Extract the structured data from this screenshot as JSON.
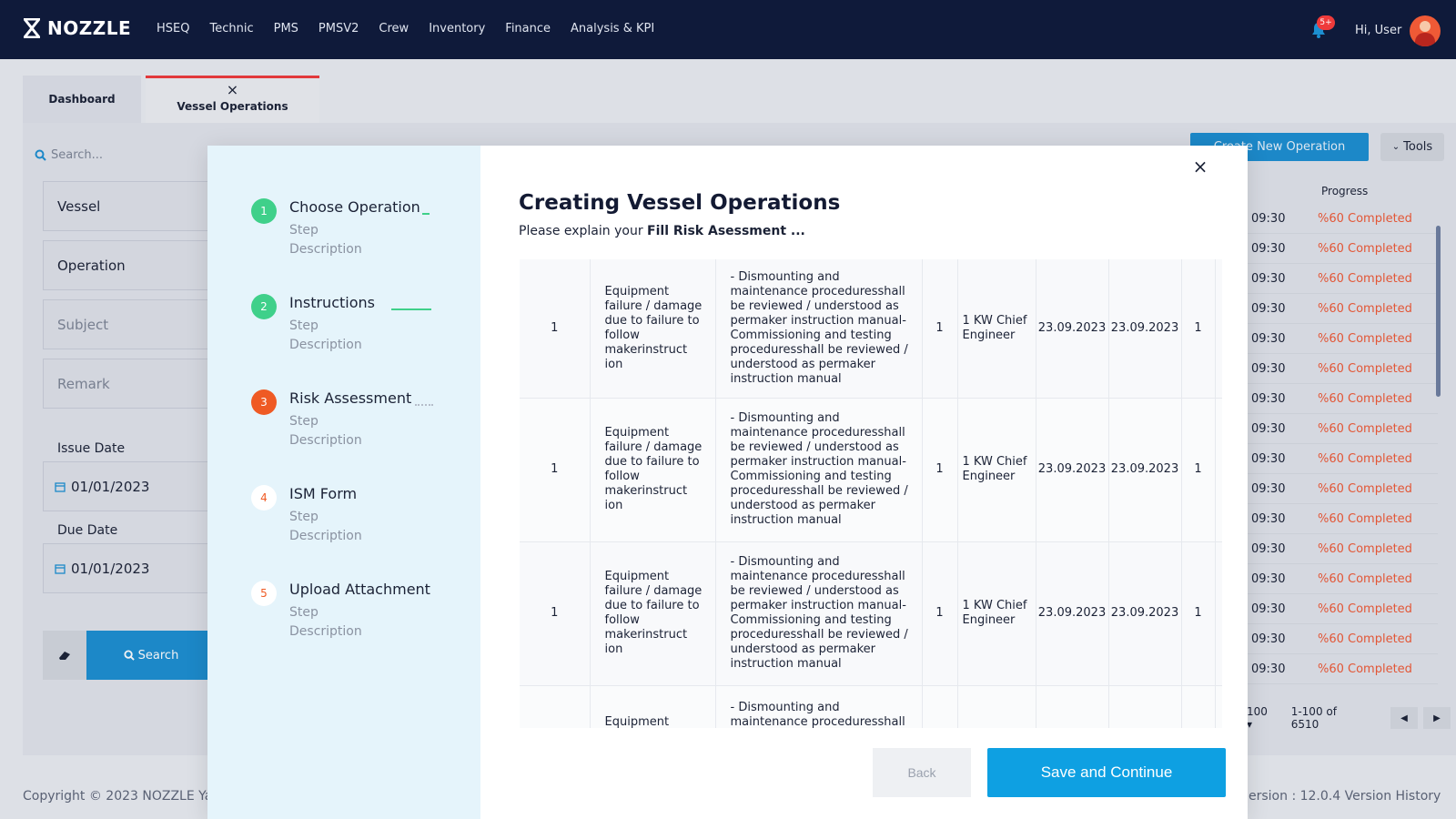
{
  "brand": {
    "name": "NOZZLE"
  },
  "nav": {
    "items": [
      "HSEQ",
      "Technic",
      "PMS",
      "PMSV2",
      "Crew",
      "Inventory",
      "Finance",
      "Analysis & KPI"
    ]
  },
  "header": {
    "notification_badge": "5+",
    "greeting": "Hi, User"
  },
  "tabs": {
    "dashboard": "Dashboard",
    "vessel_operations": "Vessel Operations"
  },
  "filters": {
    "search_placeholder": "Search...",
    "vessel": "Vessel",
    "operation": "Operation",
    "subject": "Subject",
    "remark": "Remark",
    "issue_date_label": "Issue Date",
    "issue_date": "01/01/2023",
    "due_date_label": "Due Date",
    "due_date": "01/01/2023",
    "search_button": "Search"
  },
  "toolbar": {
    "create": "Create New Operation",
    "tools": "Tools"
  },
  "list": {
    "progress_header": "Progress",
    "rows": [
      {
        "time": "09:30",
        "progress": "%60 Completed"
      },
      {
        "time": "09:30",
        "progress": "%60 Completed"
      },
      {
        "time": "09:30",
        "progress": "%60 Completed"
      },
      {
        "time": "09:30",
        "progress": "%60 Completed"
      },
      {
        "time": "09:30",
        "progress": "%60 Completed"
      },
      {
        "time": "09:30",
        "progress": "%60 Completed"
      },
      {
        "time": "09:30",
        "progress": "%60 Completed"
      },
      {
        "time": "09:30",
        "progress": "%60 Completed"
      },
      {
        "time": "09:30",
        "progress": "%60 Completed"
      },
      {
        "time": "09:30",
        "progress": "%60 Completed"
      },
      {
        "time": "09:30",
        "progress": "%60 Completed"
      },
      {
        "time": "09:30",
        "progress": "%60 Completed"
      },
      {
        "time": "09:30",
        "progress": "%60 Completed"
      },
      {
        "time": "09:30",
        "progress": "%60 Completed"
      },
      {
        "time": "09:30",
        "progress": "%60 Completed"
      },
      {
        "time": "09:30",
        "progress": "%60 Completed"
      }
    ],
    "per_page": "100",
    "range": "1-100 of 6510"
  },
  "footer": {
    "copyright": "Copyright © 2023  NOZZLE Ya",
    "version": "ersion : 12.0.4   Version History"
  },
  "modal": {
    "title": "Creating Vessel Operations",
    "subtitle_prefix": "Please explain your ",
    "subtitle_bold": "Fill Risk Asessment ...",
    "steps": [
      {
        "num": "1",
        "title": "Choose Operation",
        "line1": "Step",
        "line2": "Description"
      },
      {
        "num": "2",
        "title": "Instructions",
        "line1": "Step",
        "line2": "Description"
      },
      {
        "num": "3",
        "title": "Risk Assessment",
        "line1": "Step",
        "line2": "Description"
      },
      {
        "num": "4",
        "title": "ISM Form",
        "line1": "Step",
        "line2": "Description"
      },
      {
        "num": "5",
        "title": "Upload Attachment",
        "line1": "Step",
        "line2": "Description"
      }
    ],
    "rows": [
      {
        "a": "1",
        "hazard": "Equipment failure / damage due to failure to follow makerinstruct ion",
        "measure": "- Dismounting and maintenance proceduresshall be reviewed / understood as permaker instruction manual- Commissioning and testing proceduresshall be reviewed / understood as permaker instruction manual",
        "b": "1",
        "resp": "1 KW Chief Engineer",
        "d1": "23.09.2023",
        "d2": "23.09.2023",
        "c": "1"
      },
      {
        "a": "1",
        "hazard": "Equipment failure / damage due to failure to follow makerinstruct ion",
        "measure": "- Dismounting and maintenance proceduresshall be reviewed / understood as permaker instruction manual- Commissioning and testing proceduresshall be reviewed / understood as permaker instruction manual",
        "b": "1",
        "resp": "1 KW Chief Engineer",
        "d1": "23.09.2023",
        "d2": "23.09.2023",
        "c": "1"
      },
      {
        "a": "1",
        "hazard": "Equipment failure / damage due to failure to follow makerinstruct ion",
        "measure": "- Dismounting and maintenance proceduresshall be reviewed / understood as permaker instruction manual- Commissioning and testing proceduresshall be reviewed / understood as permaker instruction manual",
        "b": "1",
        "resp": "1 KW Chief Engineer",
        "d1": "23.09.2023",
        "d2": "23.09.2023",
        "c": "1"
      },
      {
        "a": "",
        "hazard": "Equipment",
        "measure": "- Dismounting and maintenance proceduresshall",
        "b": "",
        "resp": "",
        "d1": "",
        "d2": "",
        "c": ""
      }
    ],
    "back": "Back",
    "save": "Save and Continue"
  },
  "colors": {
    "navy": "#0f1a3a",
    "primary": "#0ea0e2",
    "success": "#3fd08a",
    "active": "#ef5a24",
    "progress": "#ef5a36"
  }
}
